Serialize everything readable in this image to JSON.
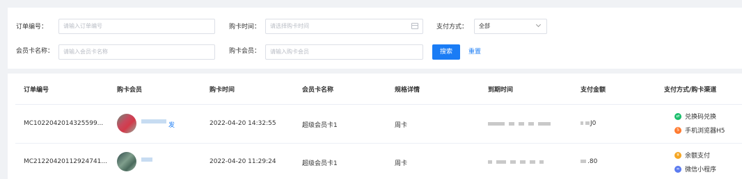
{
  "filters": {
    "order_no": {
      "label": "订单编号：",
      "placeholder": "请输入订单编号"
    },
    "purchase_time": {
      "label": "购卡时间：",
      "placeholder": "请选择购卡时间"
    },
    "pay_method": {
      "label": "支付方式：",
      "value": "全部"
    },
    "card_name": {
      "label": "会员卡名称：",
      "placeholder": "请输入会员卡名称"
    },
    "member": {
      "label": "购卡会员：",
      "placeholder": "请输入购卡会员"
    },
    "search_label": "搜索",
    "reset_label": "重置"
  },
  "table": {
    "headers": [
      "订单编号",
      "购卡会员",
      "购卡时间",
      "会员卡名称",
      "规格详情",
      "到期时间",
      "支付金额",
      "支付方式/购卡渠道"
    ],
    "rows": [
      {
        "order_no": "MC1022042014325599...",
        "member_suffix": "发",
        "purchase_time": "2022-04-20 14:32:55",
        "card_name": "超级会员卡1",
        "spec": "周卡",
        "amount_suffix": "J0",
        "pay_method": "兑换码兑换",
        "channel": "手机浏览器H5"
      },
      {
        "order_no": "MC21220420112924741...",
        "member_suffix": "",
        "purchase_time": "2022-04-20 11:29:24",
        "card_name": "超级会员卡1",
        "spec": "周卡",
        "amount_suffix": ".80",
        "pay_method": "余额支付",
        "channel": "微信小程序"
      }
    ]
  },
  "colors": {
    "accent": "#1a7cf5",
    "exchange": "#19be6b",
    "h5": "#ff7a2f",
    "balance": "#f5a623",
    "miniapp": "#5b7bf0"
  },
  "icons": [
    "calendar-icon",
    "chevron-down-icon",
    "exchange-icon",
    "html5-icon",
    "yuan-icon",
    "miniprogram-icon"
  ]
}
